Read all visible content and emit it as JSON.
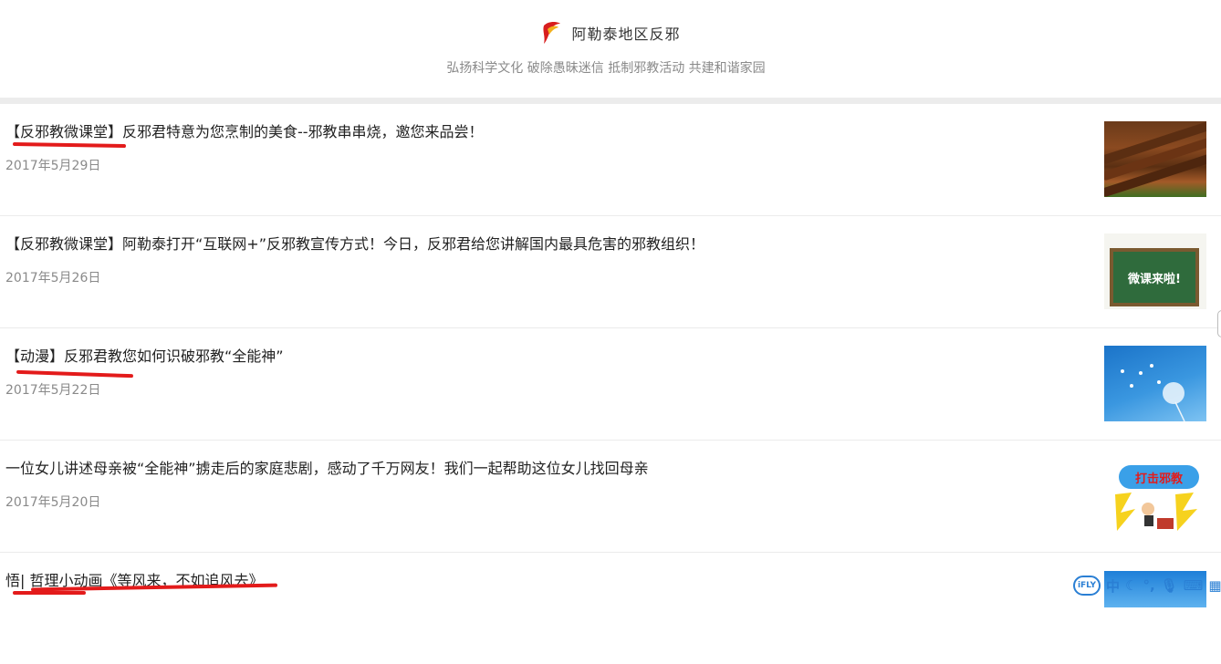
{
  "header": {
    "account_name": "阿勒泰地区反邪",
    "slogan": "弘扬科学文化 破除愚昧迷信 抵制邪教活动  共建和谐家园"
  },
  "articles": [
    {
      "title": "【反邪教微课堂】反邪君特意为您烹制的美食--邪教串串烧，邀您来品尝！",
      "date": "2017年5月29日",
      "thumb": "barbecue-skewers-image"
    },
    {
      "title": "【反邪教微课堂】阿勒泰打开“互联网+”反邪教宣传方式！今日，反邪君给您讲解国内最具危害的邪教组织！",
      "date": "2017年5月26日",
      "thumb": "chalkboard-image",
      "thumb_text": "微课来啦!"
    },
    {
      "title": "【动漫】反邪君教您如何识破邪教“全能神”",
      "date": "2017年5月22日",
      "thumb": "dandelion-image"
    },
    {
      "title": "一位女儿讲述母亲被“全能神”掳走后的家庭悲剧，感动了千万网友！我们一起帮助这位女儿找回母亲",
      "date": "2017年5月20日",
      "thumb": "cartoon-image",
      "thumb_text": "打击邪教"
    },
    {
      "title": "悟| 哲理小动画《等风来，不如追风去》",
      "date": "",
      "thumb": "blue-image"
    }
  ],
  "ime_toolbar": {
    "logo_text": "iFLY",
    "lang": "中"
  },
  "colors": {
    "accent_red": "#e31b1b",
    "ime_blue": "#2a7fd4",
    "muted_text": "#8a8a8a"
  }
}
